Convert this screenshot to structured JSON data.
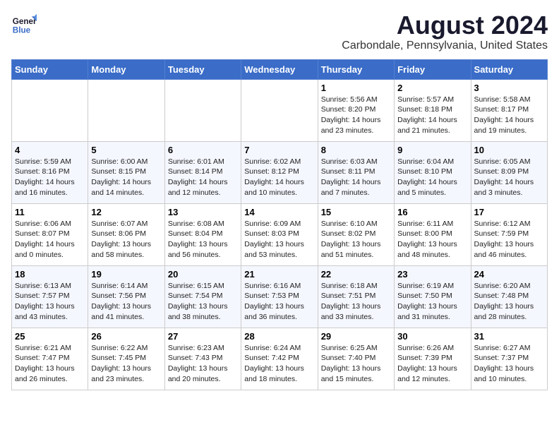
{
  "header": {
    "logo_line1": "General",
    "logo_line2": "Blue",
    "month_year": "August 2024",
    "location": "Carbondale, Pennsylvania, United States"
  },
  "weekdays": [
    "Sunday",
    "Monday",
    "Tuesday",
    "Wednesday",
    "Thursday",
    "Friday",
    "Saturday"
  ],
  "weeks": [
    [
      {
        "day": "",
        "info": ""
      },
      {
        "day": "",
        "info": ""
      },
      {
        "day": "",
        "info": ""
      },
      {
        "day": "",
        "info": ""
      },
      {
        "day": "1",
        "info": "Sunrise: 5:56 AM\nSunset: 8:20 PM\nDaylight: 14 hours\nand 23 minutes."
      },
      {
        "day": "2",
        "info": "Sunrise: 5:57 AM\nSunset: 8:18 PM\nDaylight: 14 hours\nand 21 minutes."
      },
      {
        "day": "3",
        "info": "Sunrise: 5:58 AM\nSunset: 8:17 PM\nDaylight: 14 hours\nand 19 minutes."
      }
    ],
    [
      {
        "day": "4",
        "info": "Sunrise: 5:59 AM\nSunset: 8:16 PM\nDaylight: 14 hours\nand 16 minutes."
      },
      {
        "day": "5",
        "info": "Sunrise: 6:00 AM\nSunset: 8:15 PM\nDaylight: 14 hours\nand 14 minutes."
      },
      {
        "day": "6",
        "info": "Sunrise: 6:01 AM\nSunset: 8:14 PM\nDaylight: 14 hours\nand 12 minutes."
      },
      {
        "day": "7",
        "info": "Sunrise: 6:02 AM\nSunset: 8:12 PM\nDaylight: 14 hours\nand 10 minutes."
      },
      {
        "day": "8",
        "info": "Sunrise: 6:03 AM\nSunset: 8:11 PM\nDaylight: 14 hours\nand 7 minutes."
      },
      {
        "day": "9",
        "info": "Sunrise: 6:04 AM\nSunset: 8:10 PM\nDaylight: 14 hours\nand 5 minutes."
      },
      {
        "day": "10",
        "info": "Sunrise: 6:05 AM\nSunset: 8:09 PM\nDaylight: 14 hours\nand 3 minutes."
      }
    ],
    [
      {
        "day": "11",
        "info": "Sunrise: 6:06 AM\nSunset: 8:07 PM\nDaylight: 14 hours\nand 0 minutes."
      },
      {
        "day": "12",
        "info": "Sunrise: 6:07 AM\nSunset: 8:06 PM\nDaylight: 13 hours\nand 58 minutes."
      },
      {
        "day": "13",
        "info": "Sunrise: 6:08 AM\nSunset: 8:04 PM\nDaylight: 13 hours\nand 56 minutes."
      },
      {
        "day": "14",
        "info": "Sunrise: 6:09 AM\nSunset: 8:03 PM\nDaylight: 13 hours\nand 53 minutes."
      },
      {
        "day": "15",
        "info": "Sunrise: 6:10 AM\nSunset: 8:02 PM\nDaylight: 13 hours\nand 51 minutes."
      },
      {
        "day": "16",
        "info": "Sunrise: 6:11 AM\nSunset: 8:00 PM\nDaylight: 13 hours\nand 48 minutes."
      },
      {
        "day": "17",
        "info": "Sunrise: 6:12 AM\nSunset: 7:59 PM\nDaylight: 13 hours\nand 46 minutes."
      }
    ],
    [
      {
        "day": "18",
        "info": "Sunrise: 6:13 AM\nSunset: 7:57 PM\nDaylight: 13 hours\nand 43 minutes."
      },
      {
        "day": "19",
        "info": "Sunrise: 6:14 AM\nSunset: 7:56 PM\nDaylight: 13 hours\nand 41 minutes."
      },
      {
        "day": "20",
        "info": "Sunrise: 6:15 AM\nSunset: 7:54 PM\nDaylight: 13 hours\nand 38 minutes."
      },
      {
        "day": "21",
        "info": "Sunrise: 6:16 AM\nSunset: 7:53 PM\nDaylight: 13 hours\nand 36 minutes."
      },
      {
        "day": "22",
        "info": "Sunrise: 6:18 AM\nSunset: 7:51 PM\nDaylight: 13 hours\nand 33 minutes."
      },
      {
        "day": "23",
        "info": "Sunrise: 6:19 AM\nSunset: 7:50 PM\nDaylight: 13 hours\nand 31 minutes."
      },
      {
        "day": "24",
        "info": "Sunrise: 6:20 AM\nSunset: 7:48 PM\nDaylight: 13 hours\nand 28 minutes."
      }
    ],
    [
      {
        "day": "25",
        "info": "Sunrise: 6:21 AM\nSunset: 7:47 PM\nDaylight: 13 hours\nand 26 minutes."
      },
      {
        "day": "26",
        "info": "Sunrise: 6:22 AM\nSunset: 7:45 PM\nDaylight: 13 hours\nand 23 minutes."
      },
      {
        "day": "27",
        "info": "Sunrise: 6:23 AM\nSunset: 7:43 PM\nDaylight: 13 hours\nand 20 minutes."
      },
      {
        "day": "28",
        "info": "Sunrise: 6:24 AM\nSunset: 7:42 PM\nDaylight: 13 hours\nand 18 minutes."
      },
      {
        "day": "29",
        "info": "Sunrise: 6:25 AM\nSunset: 7:40 PM\nDaylight: 13 hours\nand 15 minutes."
      },
      {
        "day": "30",
        "info": "Sunrise: 6:26 AM\nSunset: 7:39 PM\nDaylight: 13 hours\nand 12 minutes."
      },
      {
        "day": "31",
        "info": "Sunrise: 6:27 AM\nSunset: 7:37 PM\nDaylight: 13 hours\nand 10 minutes."
      }
    ]
  ]
}
